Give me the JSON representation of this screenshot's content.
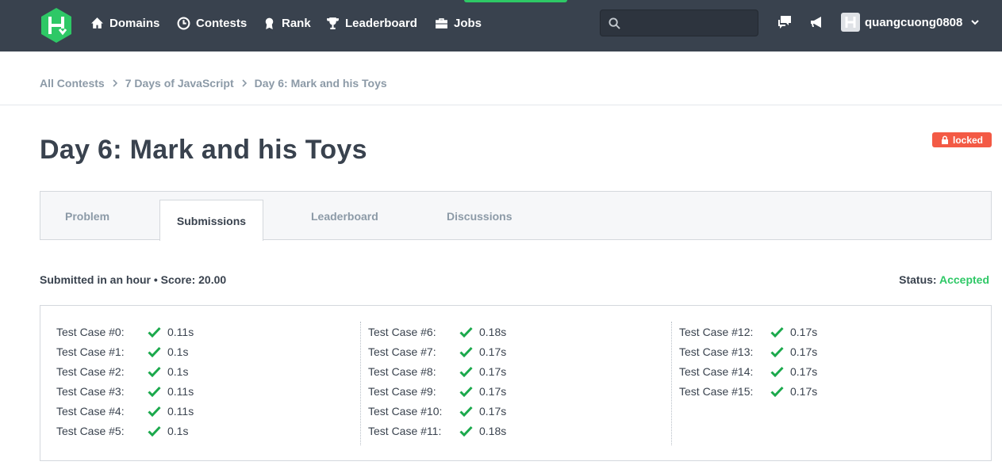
{
  "nav": {
    "items": [
      {
        "label": "Domains",
        "icon": "home-icon"
      },
      {
        "label": "Contests",
        "icon": "clock-icon"
      },
      {
        "label": "Rank",
        "icon": "medal-icon"
      },
      {
        "label": "Leaderboard",
        "icon": "trophy-icon"
      },
      {
        "label": "Jobs",
        "icon": "briefcase-icon"
      }
    ],
    "search_value": "",
    "username": "quangcuong0808",
    "accent_color": "#2ec866",
    "bg_color": "#39424e"
  },
  "breadcrumb": [
    "All Contests",
    "7 Days of JavaScript",
    "Day 6: Mark and his Toys"
  ],
  "page": {
    "title": "Day 6: Mark and his Toys",
    "locked_label": "locked"
  },
  "tabs": [
    "Problem",
    "Submissions",
    "Leaderboard",
    "Discussions"
  ],
  "submission": {
    "summary": "Submitted in an hour • Score: 20.00",
    "status_label": "Status:",
    "status_value": "Accepted",
    "status_color": "#2ec866"
  },
  "test_cases": [
    [
      {
        "label": "Test Case #0:",
        "time": "0.11s"
      },
      {
        "label": "Test Case #1:",
        "time": "0.1s"
      },
      {
        "label": "Test Case #2:",
        "time": "0.1s"
      },
      {
        "label": "Test Case #3:",
        "time": "0.11s"
      },
      {
        "label": "Test Case #4:",
        "time": "0.11s"
      },
      {
        "label": "Test Case #5:",
        "time": "0.1s"
      }
    ],
    [
      {
        "label": "Test Case #6:",
        "time": "0.18s"
      },
      {
        "label": "Test Case #7:",
        "time": "0.17s"
      },
      {
        "label": "Test Case #8:",
        "time": "0.17s"
      },
      {
        "label": "Test Case #9:",
        "time": "0.17s"
      },
      {
        "label": "Test Case #10:",
        "time": "0.17s"
      },
      {
        "label": "Test Case #11:",
        "time": "0.18s"
      }
    ],
    [
      {
        "label": "Test Case #12:",
        "time": "0.17s"
      },
      {
        "label": "Test Case #13:",
        "time": "0.17s"
      },
      {
        "label": "Test Case #14:",
        "time": "0.17s"
      },
      {
        "label": "Test Case #15:",
        "time": "0.17s"
      }
    ]
  ]
}
